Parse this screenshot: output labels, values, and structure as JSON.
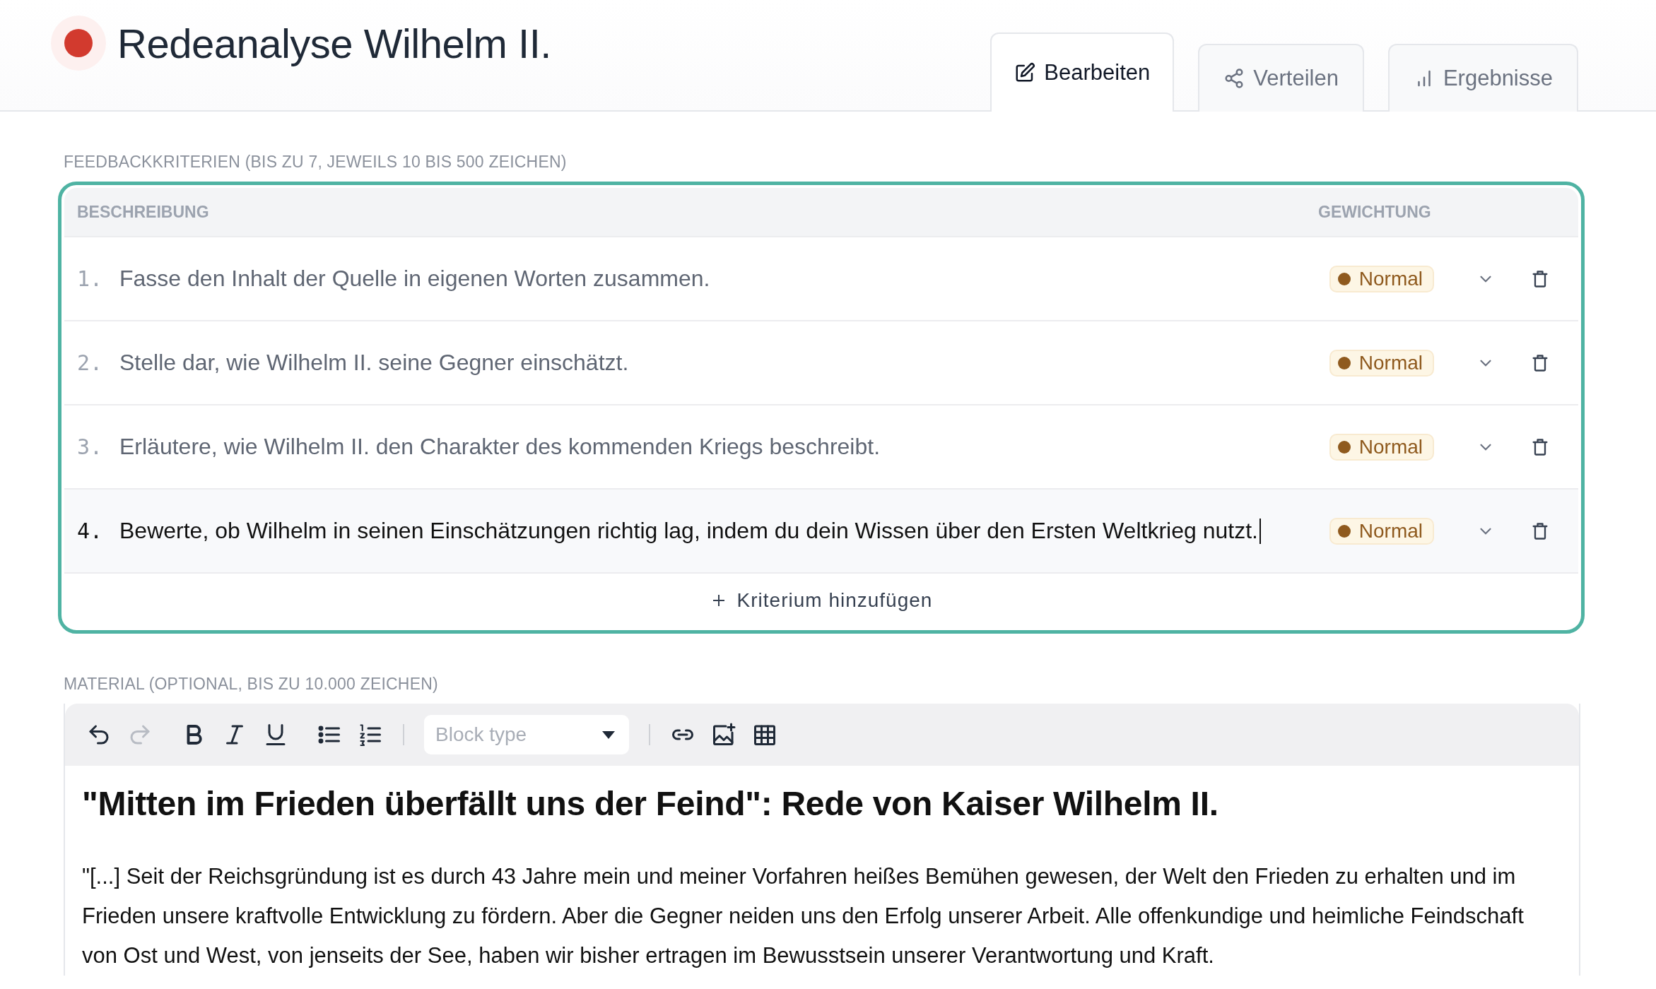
{
  "header": {
    "title": "Redeanalyse Wilhelm II."
  },
  "tabs": [
    {
      "label": "Bearbeiten",
      "kind": "edit",
      "selected": true
    },
    {
      "label": "Verteilen",
      "kind": "share",
      "selected": false
    },
    {
      "label": "Ergebnisse",
      "kind": "chart",
      "selected": false
    }
  ],
  "criteria": {
    "label": "FEEDBACKKRITERIEN (BIS ZU 7, JEWEILS 10 BIS 500 ZEICHEN)",
    "columns": [
      "BESCHREIBUNG",
      "GEWICHTUNG"
    ],
    "rows": [
      {
        "number": "1.",
        "text": "Fasse den Inhalt der Quelle in eigenen Worten zusammen.",
        "weight": "Normal",
        "active": false
      },
      {
        "number": "2.",
        "text": "Stelle dar, wie Wilhelm II. seine Gegner einschätzt.",
        "weight": "Normal",
        "active": false
      },
      {
        "number": "3.",
        "text": "Erläutere, wie Wilhelm II. den Charakter des kommenden Kriegs beschreibt.",
        "weight": "Normal",
        "active": false
      },
      {
        "number": "4.",
        "text": "Bewerte, ob Wilhelm in seinen Einschätzungen richtig lag, indem du dein Wissen über den Ersten Weltkrieg nutzt.",
        "weight": "Normal",
        "active": true
      }
    ],
    "add_button": "Kriterium hinzufügen"
  },
  "material": {
    "label": "MATERIAL (OPTIONAL, BIS ZU 10.000 ZEICHEN)",
    "toolbar": {
      "history": [
        {
          "kind": "undo",
          "disabled": false
        },
        {
          "kind": "redo",
          "disabled": true
        }
      ],
      "formatting": [
        {
          "kind": "bold"
        },
        {
          "kind": "italic"
        },
        {
          "kind": "underline"
        }
      ],
      "lists": [
        {
          "kind": "bullet"
        },
        {
          "kind": "numbered"
        }
      ],
      "block_type": {
        "placeholder": "Block type"
      },
      "insert": [
        {
          "kind": "link"
        },
        {
          "kind": "image"
        },
        {
          "kind": "table"
        }
      ]
    },
    "heading": "\"Mitten im Frieden überfällt uns der Feind\": Rede von Kaiser Wilhelm II.",
    "paragraph": "\"[...] Seit der Reichsgründung ist es durch 43 Jahre mein und meiner Vorfahren heißes Bemühen gewesen, der Welt den Frieden zu erhalten und im Frieden unsere kraftvolle Entwicklung zu fördern. Aber die Gegner neiden uns den Erfolg unserer Arbeit. Alle offenkundige und heimliche Feindschaft von Ost und West, von jenseits der See, haben wir bisher ertragen im Bewusstsein unserer Verantwortung und Kraft."
  }
}
